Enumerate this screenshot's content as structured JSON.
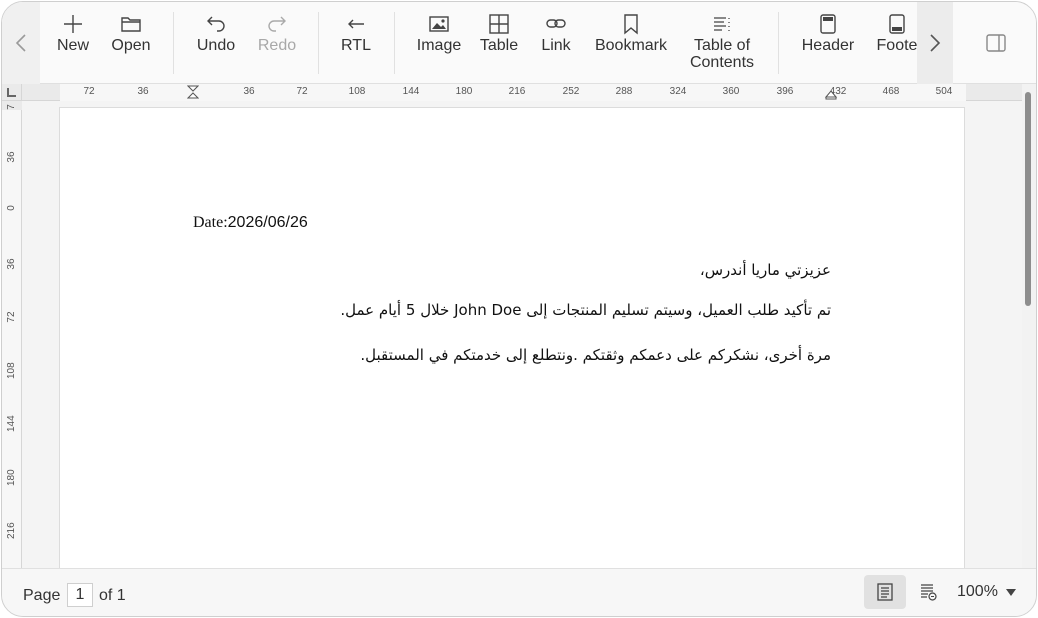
{
  "toolbar": {
    "items": [
      {
        "id": "new",
        "label": "New",
        "icon": "plus-icon"
      },
      {
        "id": "open",
        "label": "Open",
        "icon": "folder-icon"
      },
      {
        "id": "undo",
        "label": "Undo",
        "icon": "undo-icon"
      },
      {
        "id": "redo",
        "label": "Redo",
        "icon": "redo-icon",
        "disabled": true
      },
      {
        "id": "rtl",
        "label": "RTL",
        "icon": "arrow-left-icon"
      },
      {
        "id": "image",
        "label": "Image",
        "icon": "image-icon"
      },
      {
        "id": "table",
        "label": "Table",
        "icon": "table-icon"
      },
      {
        "id": "link",
        "label": "Link",
        "icon": "link-icon"
      },
      {
        "id": "bookmark",
        "label": "Bookmark",
        "icon": "bookmark-icon"
      },
      {
        "id": "toc",
        "label": "Table of Contents",
        "icon": "toc-icon"
      },
      {
        "id": "header",
        "label": "Header",
        "icon": "header-icon"
      },
      {
        "id": "footer",
        "label": "Foote",
        "icon": "footer-icon"
      }
    ]
  },
  "ruler": {
    "horizontal_ticks": [
      "72",
      "36",
      "36",
      "72",
      "108",
      "144",
      "180",
      "216",
      "252",
      "288",
      "324",
      "360",
      "396",
      "432",
      "468",
      "504"
    ],
    "vertical_ticks": [
      "7",
      "36",
      "0",
      "36",
      "72",
      "108",
      "144",
      "180",
      "216"
    ]
  },
  "document": {
    "date_label": "Date:",
    "date_value": "2026/06/26",
    "paragraphs": [
      "عزيزتي ماريا أندرس،",
      "تم تأكيد طلب العميل، وسيتم تسليم المنتجات إلى John Doe خلال 5 أيام عمل.",
      "مرة أخرى، نشكركم على دعمكم وثقتكم .ونتطلع إلى خدمتكم في المستقبل."
    ]
  },
  "status": {
    "page_label": "Page",
    "current_page": "1",
    "of_label": "of",
    "total_pages": "1",
    "zoom": "100%"
  }
}
